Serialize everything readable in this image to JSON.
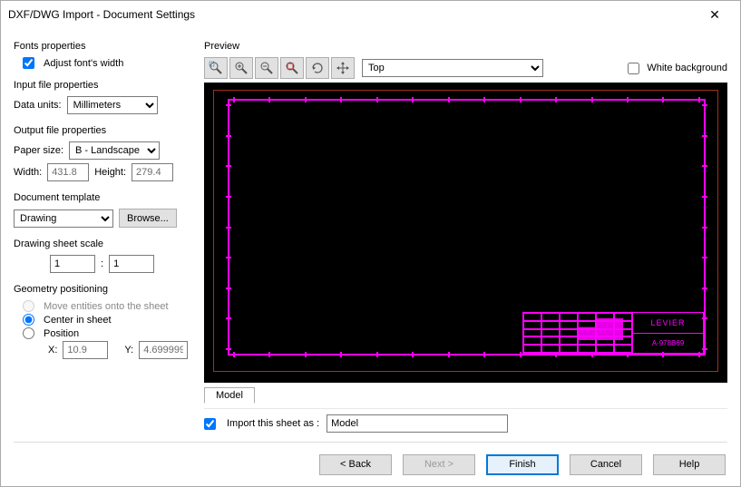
{
  "window": {
    "title": "DXF/DWG Import - Document Settings"
  },
  "fonts": {
    "group": "Fonts properties",
    "adjust_label": "Adjust font's width",
    "adjust_checked": true
  },
  "input_file": {
    "group": "Input file properties",
    "data_units_label": "Data units:",
    "data_units_value": "Millimeters"
  },
  "output_file": {
    "group": "Output file properties",
    "paper_size_label": "Paper size:",
    "paper_size_value": "B - Landscape",
    "width_label": "Width:",
    "width_value": "431.8",
    "height_label": "Height:",
    "height_value": "279.4"
  },
  "doc_template": {
    "group": "Document template",
    "value": "Drawing",
    "browse": "Browse..."
  },
  "sheet_scale": {
    "group": "Drawing sheet scale",
    "num": "1",
    "sep": ":",
    "den": "1"
  },
  "geom": {
    "group": "Geometry positioning",
    "move": "Move entities onto the sheet",
    "center": "Center in sheet",
    "position": "Position",
    "selected": "center",
    "x_label": "X:",
    "x_value": "10.9",
    "y_label": "Y:",
    "y_value": "4.699999"
  },
  "preview": {
    "group": "Preview",
    "view": "Top",
    "white_bg_label": "White background",
    "white_bg_checked": false,
    "title_block": {
      "name": "LEVIER",
      "code": "A-978B69"
    }
  },
  "tabs": {
    "model": "Model"
  },
  "import": {
    "label": "Import this sheet as :",
    "value": "Model",
    "checked": true
  },
  "footer": {
    "back": "< Back",
    "next": "Next >",
    "finish": "Finish",
    "cancel": "Cancel",
    "help": "Help"
  },
  "icons": {
    "zoom_area": "zoom-area",
    "zoom_in": "zoom-in",
    "zoom_out": "zoom-out",
    "zoom_fit": "zoom-fit",
    "rotate": "rotate",
    "pan": "pan"
  }
}
